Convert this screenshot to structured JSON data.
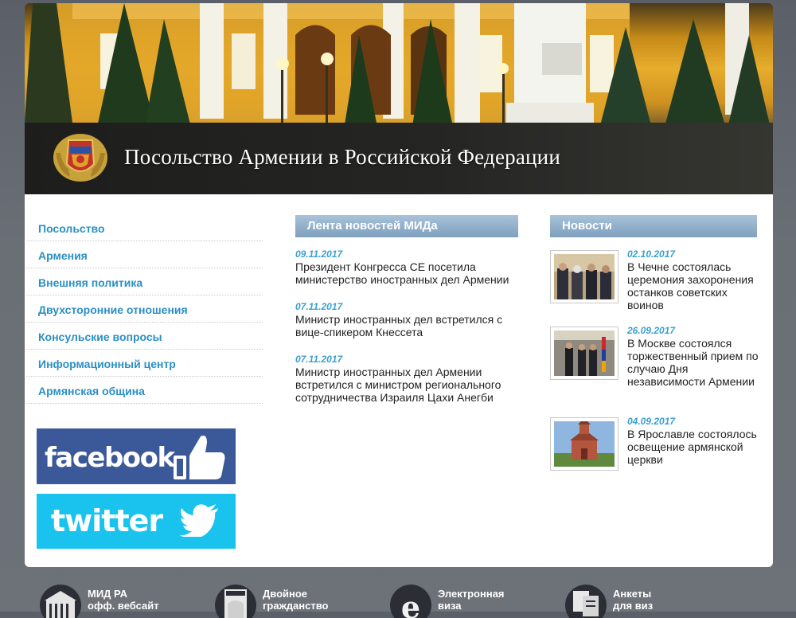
{
  "header": {
    "site_title": "Посольство Армении в Российской Федерации"
  },
  "nav": [
    {
      "label": "Посольство"
    },
    {
      "label": "Армения"
    },
    {
      "label": "Внешняя политика"
    },
    {
      "label": "Двухсторонние отношения"
    },
    {
      "label": "Консульские вопросы"
    },
    {
      "label": "Информационный центр"
    },
    {
      "label": "Армянская община"
    }
  ],
  "social": {
    "facebook": "facebook",
    "twitter": "twitter"
  },
  "mfa_feed": {
    "title": "Лента новостей МИДа",
    "items": [
      {
        "date": "09.11.2017",
        "text": "Президент Конгресса СЕ посетила министерство иностранных дел Армении"
      },
      {
        "date": "07.11.2017",
        "text": "Министр иностранных дел встретился с вице-спикером Кнессета"
      },
      {
        "date": "07.11.2017",
        "text": "Министр иностранных дел Армении встретился с министром регионального сотрудничества Израиля Цахи Анегби"
      }
    ]
  },
  "news": {
    "title": "Новости",
    "items": [
      {
        "date": "02.10.2017",
        "text": "В Чечне состоялась церемония захоронения останков советских воинов"
      },
      {
        "date": "26.09.2017",
        "text": "В Москве состоялся торжественный прием по случаю Дня независимости Армении"
      },
      {
        "date": "04.09.2017",
        "text": "В Ярославле состоялось освещение армянской церкви"
      }
    ]
  },
  "footer": [
    {
      "line1": "МИД РА",
      "line2": "офф. вебсайт",
      "icon": "building-icon"
    },
    {
      "line1": "Двойное",
      "line2": "гражданство",
      "icon": "passport-icon"
    },
    {
      "line1": "Электронная",
      "line2": "виза",
      "icon": "e-visa-icon"
    },
    {
      "line1": "Анкеты",
      "line2": "для виз",
      "icon": "forms-icon"
    }
  ],
  "colors": {
    "accent_link": "#2a8fc4",
    "date_color": "#3aa0d0",
    "facebook_blue": "#3b5898",
    "twitter_blue": "#19c3ee",
    "column_header": "#8fadc8"
  }
}
